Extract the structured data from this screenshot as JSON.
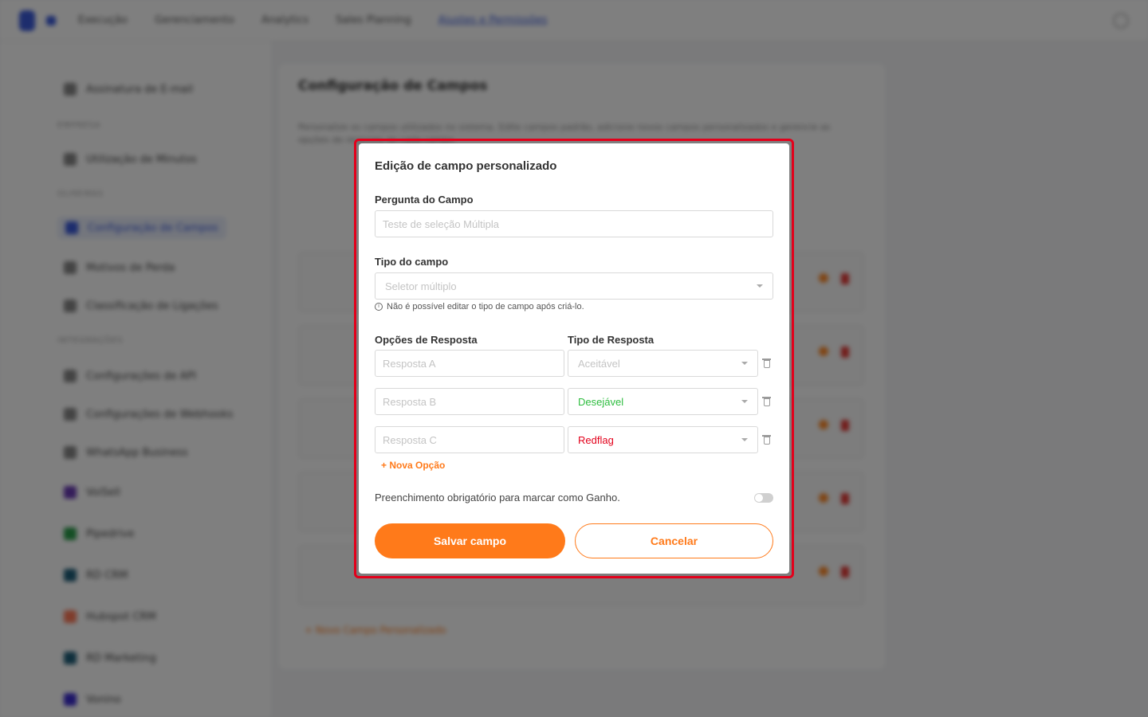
{
  "topbar": {
    "nav": [
      "Execução",
      "Gerenciamento",
      "Analytics",
      "Sales Planning",
      "Ajustes e Permissões"
    ]
  },
  "sidebar": {
    "items": [
      {
        "label": "Assinatura de E-mail",
        "section": null
      },
      {
        "label": "Utilização de Minutos",
        "section": "EMPRESA"
      },
      {
        "label": "Configuração de Campos",
        "section": "OLHEIRAS",
        "active": true
      },
      {
        "label": "Motivos de Perda",
        "section": null
      },
      {
        "label": "Classificação de Ligações",
        "section": null
      },
      {
        "label": "Configurações de API",
        "section": "INTEGRAÇÕES"
      },
      {
        "label": "Configurações de Webhooks",
        "section": null
      },
      {
        "label": "WhatsApp Business",
        "section": null
      },
      {
        "label": "VoiSell",
        "section": null
      },
      {
        "label": "Pipedrive",
        "section": null
      },
      {
        "label": "RD CRM",
        "section": null
      },
      {
        "label": "Hubspot CRM",
        "section": null
      },
      {
        "label": "RD Marketing",
        "section": null
      },
      {
        "label": "Vonino",
        "section": null
      }
    ]
  },
  "main": {
    "title": "Configuração de Campos",
    "description": "Personalize os campos utilizados no sistema. Edite campos padrão, adicione novos campos personalizados e gerencie as opções de resposta de cada campo.",
    "new_field_link": "+ Novo Campo Personalizado"
  },
  "modal": {
    "title": "Edição de campo personalizado",
    "question_label": "Pergunta do Campo",
    "question_value": "Teste de seleção Múltipla",
    "type_label": "Tipo do campo",
    "type_value": "Seletor múltiplo",
    "type_hint": "Não é possível editar o tipo de campo após criá-lo.",
    "options_label": "Opções de Resposta",
    "response_type_label": "Tipo de Resposta",
    "options": [
      {
        "answer": "Resposta A",
        "type": "Aceitável",
        "color": "#c4c4c4"
      },
      {
        "answer": "Resposta B",
        "type": "Desejável",
        "color": "#2ebd3f"
      },
      {
        "answer": "Resposta C",
        "type": "Redflag",
        "color": "#e3001b"
      }
    ],
    "new_option": "+ Nova Opção",
    "required_label": "Preenchimento obrigatório para marcar como Ganho.",
    "required_enabled": false,
    "save_label": "Salvar campo",
    "cancel_label": "Cancelar"
  },
  "colors": {
    "accent": "#ff7a1a",
    "highlight": "#e3001b",
    "brand": "#3b5bdb"
  }
}
